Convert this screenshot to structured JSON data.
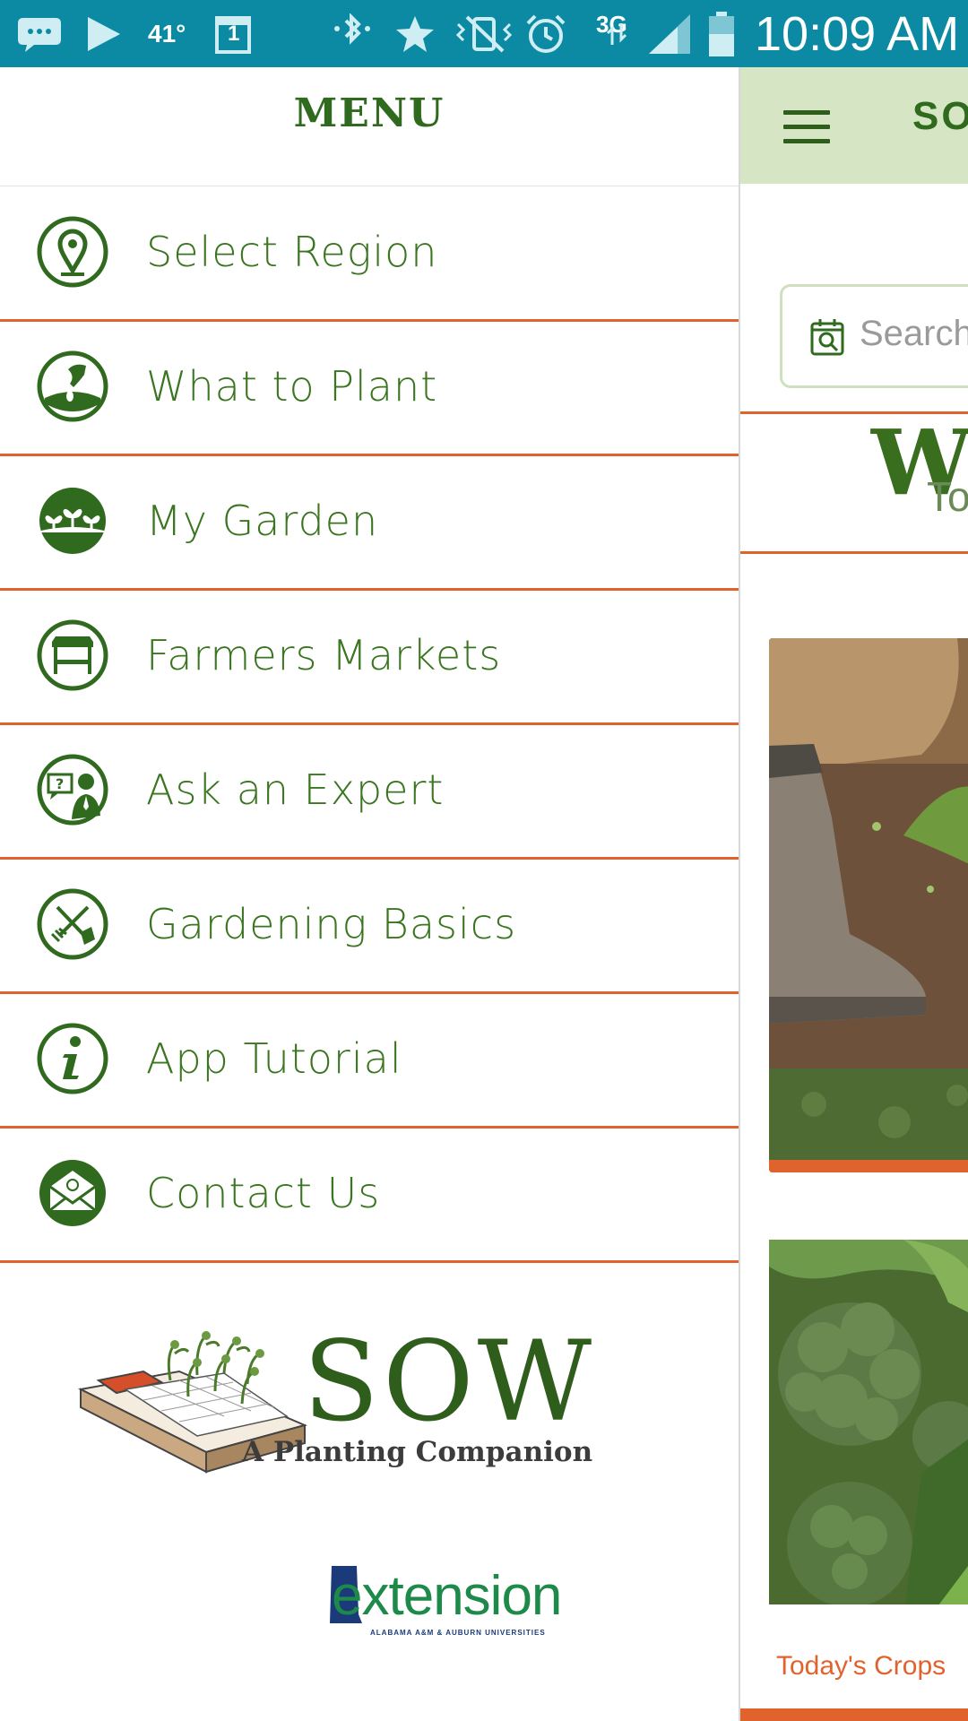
{
  "status_bar": {
    "temperature": "41°",
    "calendar_day": "1",
    "network": "3G",
    "time": "10:09 AM"
  },
  "drawer": {
    "title": "MENU",
    "items": [
      {
        "label": "Select Region",
        "icon": "location-pin-icon"
      },
      {
        "label": "What to Plant",
        "icon": "plant-seed-icon"
      },
      {
        "label": "My Garden",
        "icon": "seedlings-icon"
      },
      {
        "label": "Farmers Markets",
        "icon": "market-tent-icon"
      },
      {
        "label": "Ask an Expert",
        "icon": "expert-question-icon"
      },
      {
        "label": "Gardening Basics",
        "icon": "garden-tools-icon"
      },
      {
        "label": "App Tutorial",
        "icon": "info-icon"
      },
      {
        "label": "Contact Us",
        "icon": "mail-icon"
      }
    ],
    "logo": {
      "name": "SOW",
      "tagline": "A Planting Companion"
    },
    "extension_logo": {
      "name": "extension",
      "subtitle": "ALABAMA A&M & AUBURN UNIVERSITIES"
    }
  },
  "main": {
    "title": "SO",
    "search": {
      "placeholder": "Search"
    },
    "section_heading": "Wh",
    "section_subheading": "To",
    "bottom_nav": {
      "todays_crops": "Today's Crops"
    }
  },
  "colors": {
    "status_bar": "#0c8aa3",
    "brand_green": "#3a7520",
    "accent_orange": "#e0622c",
    "header_green": "#d6e6c4"
  }
}
